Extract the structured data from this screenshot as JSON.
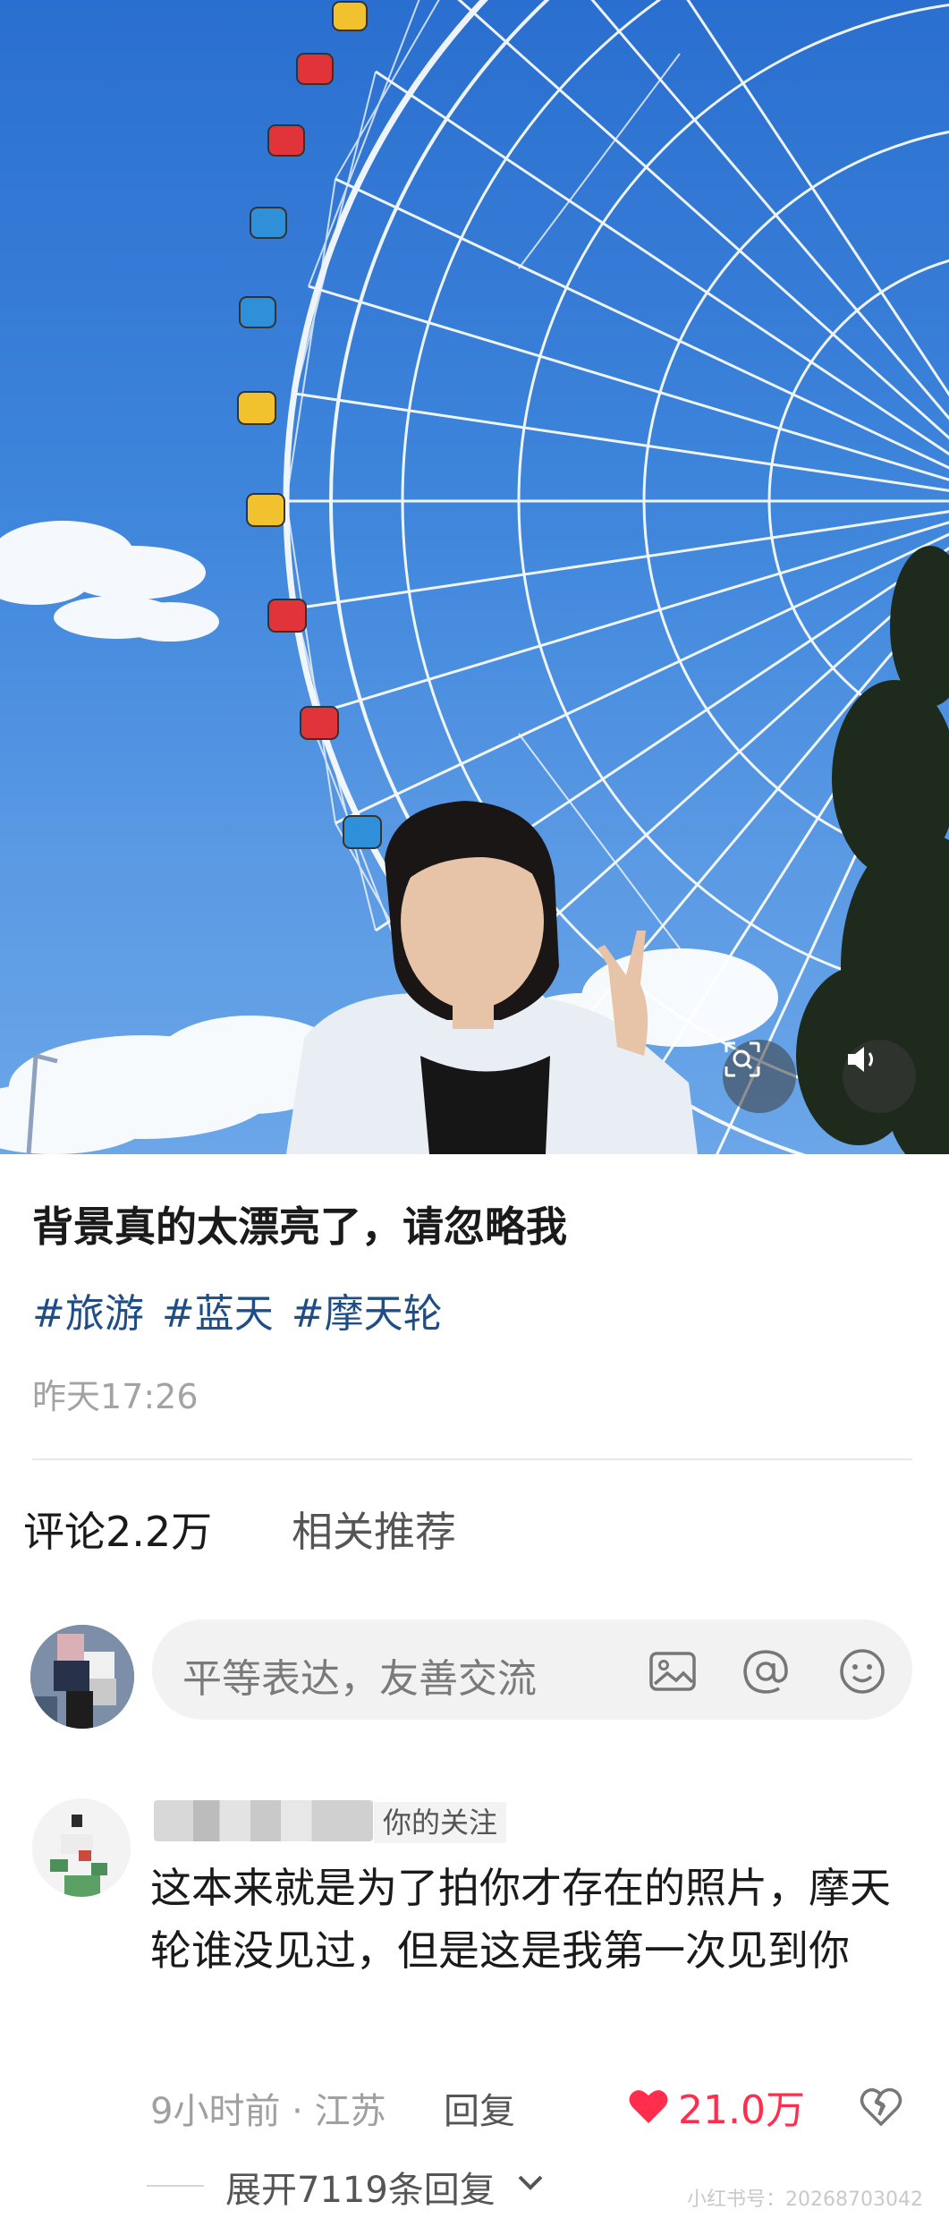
{
  "post": {
    "title": "背景真的太漂亮了，请忽略我",
    "tags": [
      "#旅游",
      "#蓝天",
      "#摩天轮"
    ],
    "time": "昨天17:26"
  },
  "tabs": {
    "comments": "评论2.2万",
    "related": "相关推荐"
  },
  "comment_input": {
    "placeholder": "平等表达，友善交流"
  },
  "comment": {
    "follow_label": "你的关注",
    "text": "这本来就是为了拍你才存在的照片，摩天轮谁没见过，但是这是我第一次见到你",
    "meta": "9小时前 · 江苏",
    "reply_label": "回复",
    "likes": "21.0万",
    "expand_label": "展开7119条回复"
  },
  "watermark": "小红书号：2026870304​2",
  "colors": {
    "sky": "#3f86dc",
    "tag": "#1f4e86",
    "like": "#ff2e4d"
  }
}
